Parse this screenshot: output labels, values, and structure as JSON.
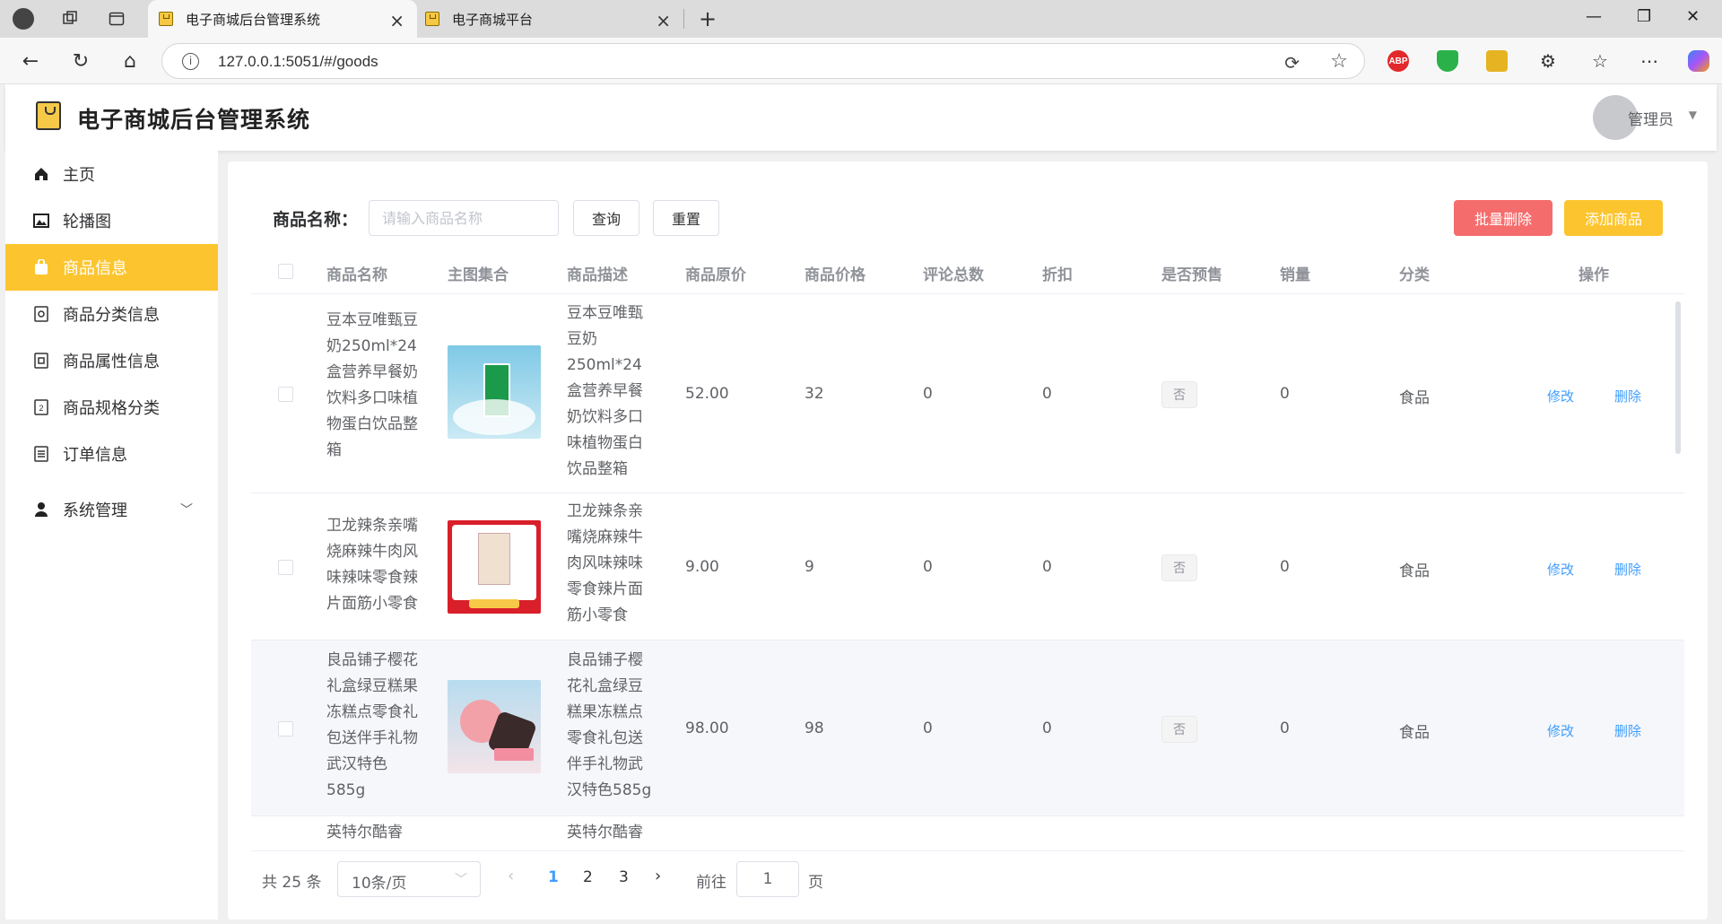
{
  "browser": {
    "tabs": [
      {
        "title": "电子商城后台管理系统",
        "active": true
      },
      {
        "title": "电子商城平台",
        "active": false
      }
    ],
    "url": "127.0.0.1:5051/#/goods",
    "new_tab_symbol": "+",
    "extensions": [
      "ABP"
    ]
  },
  "app": {
    "title": "电子商城后台管理系统",
    "user": "管理员"
  },
  "sidebar": {
    "items": [
      {
        "label": "主页",
        "icon": "home-icon"
      },
      {
        "label": "轮播图",
        "icon": "image-icon"
      },
      {
        "label": "商品信息",
        "icon": "goods-icon",
        "active": true
      },
      {
        "label": "商品分类信息",
        "icon": "category-icon"
      },
      {
        "label": "商品属性信息",
        "icon": "attribute-icon"
      },
      {
        "label": "商品规格分类",
        "icon": "spec-icon"
      },
      {
        "label": "订单信息",
        "icon": "order-icon"
      },
      {
        "label": "系统管理",
        "icon": "user-icon",
        "expandable": true
      }
    ]
  },
  "toolbar": {
    "search_label": "商品名称：",
    "search_placeholder": "请输入商品名称",
    "query_label": "查询",
    "reset_label": "重置",
    "batch_delete_label": "批量删除",
    "add_label": "添加商品"
  },
  "table": {
    "columns": [
      "商品名称",
      "主图集合",
      "商品描述",
      "商品原价",
      "商品价格",
      "评论总数",
      "折扣",
      "是否预售",
      "销量",
      "分类",
      "操作"
    ],
    "edit_label": "修改",
    "delete_label": "删除",
    "rows": [
      {
        "name": "豆本豆唯甄豆奶250ml*24盒营养早餐奶饮料多口味植物蛋白饮品整箱",
        "description": "豆本豆唯甄豆奶250ml*24盒营养早餐奶饮料多口味植物蛋白饮品整箱",
        "original_price": "52.00",
        "price": "32",
        "comments": "0",
        "discount": "0",
        "presale": "否",
        "sales": "0",
        "category": "食品",
        "image": "soy-milk-product"
      },
      {
        "name": "卫龙辣条亲嘴烧麻辣牛肉风味辣味零食辣片面筋小零食",
        "description": "卫龙辣条亲嘴烧麻辣牛肉风味辣味零食辣片面筋小零食",
        "original_price": "9.00",
        "price": "9",
        "comments": "0",
        "discount": "0",
        "presale": "否",
        "sales": "0",
        "category": "食品",
        "image": "spicy-snack-product"
      },
      {
        "name": "良品铺子樱花礼盒绿豆糕果冻糕点零食礼包送伴手礼物武汉特色585g",
        "description": "良品铺子樱花礼盒绿豆糕果冻糕点零食礼包送伴手礼物武汉特色585g",
        "original_price": "98.00",
        "price": "98",
        "comments": "0",
        "discount": "0",
        "presale": "否",
        "sales": "0",
        "category": "食品",
        "image": "sakura-cake-product"
      },
      {
        "name": "英特尔酷睿",
        "description": "英特尔酷睿"
      }
    ]
  },
  "pagination": {
    "total_text": "共 25 条",
    "page_size": "10条/页",
    "pages": [
      "1",
      "2",
      "3"
    ],
    "current_page": "1",
    "goto_label": "前往",
    "goto_value": "1",
    "goto_unit": "页"
  }
}
